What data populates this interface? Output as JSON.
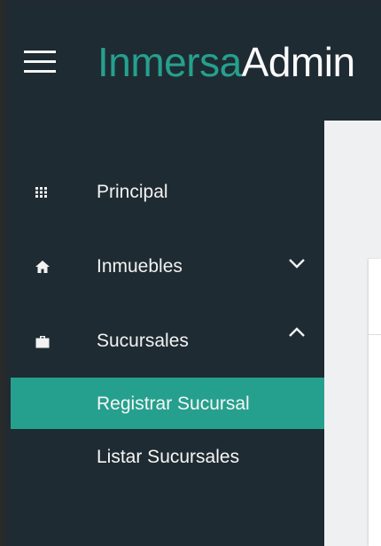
{
  "header": {
    "logo_brand": "Inmersa",
    "logo_suffix": "Admin",
    "menu_icon": "hamburger-menu-icon",
    "brand_color": "#26a08e",
    "bar_color": "#1e2b33"
  },
  "sidebar": {
    "items": [
      {
        "label": "Principal",
        "icon": "grid-icon"
      },
      {
        "label": "Inmuebles",
        "icon": "home-icon",
        "chevron": "chevron-down-icon"
      },
      {
        "label": "Sucursales",
        "icon": "briefcase-icon",
        "chevron": "chevron-up-icon",
        "expanded": true
      }
    ],
    "subitems": [
      {
        "label": "Registrar Sucursal",
        "active": true
      },
      {
        "label": "Listar Sucursales",
        "active": false
      }
    ],
    "active_color": "#26a08e"
  }
}
